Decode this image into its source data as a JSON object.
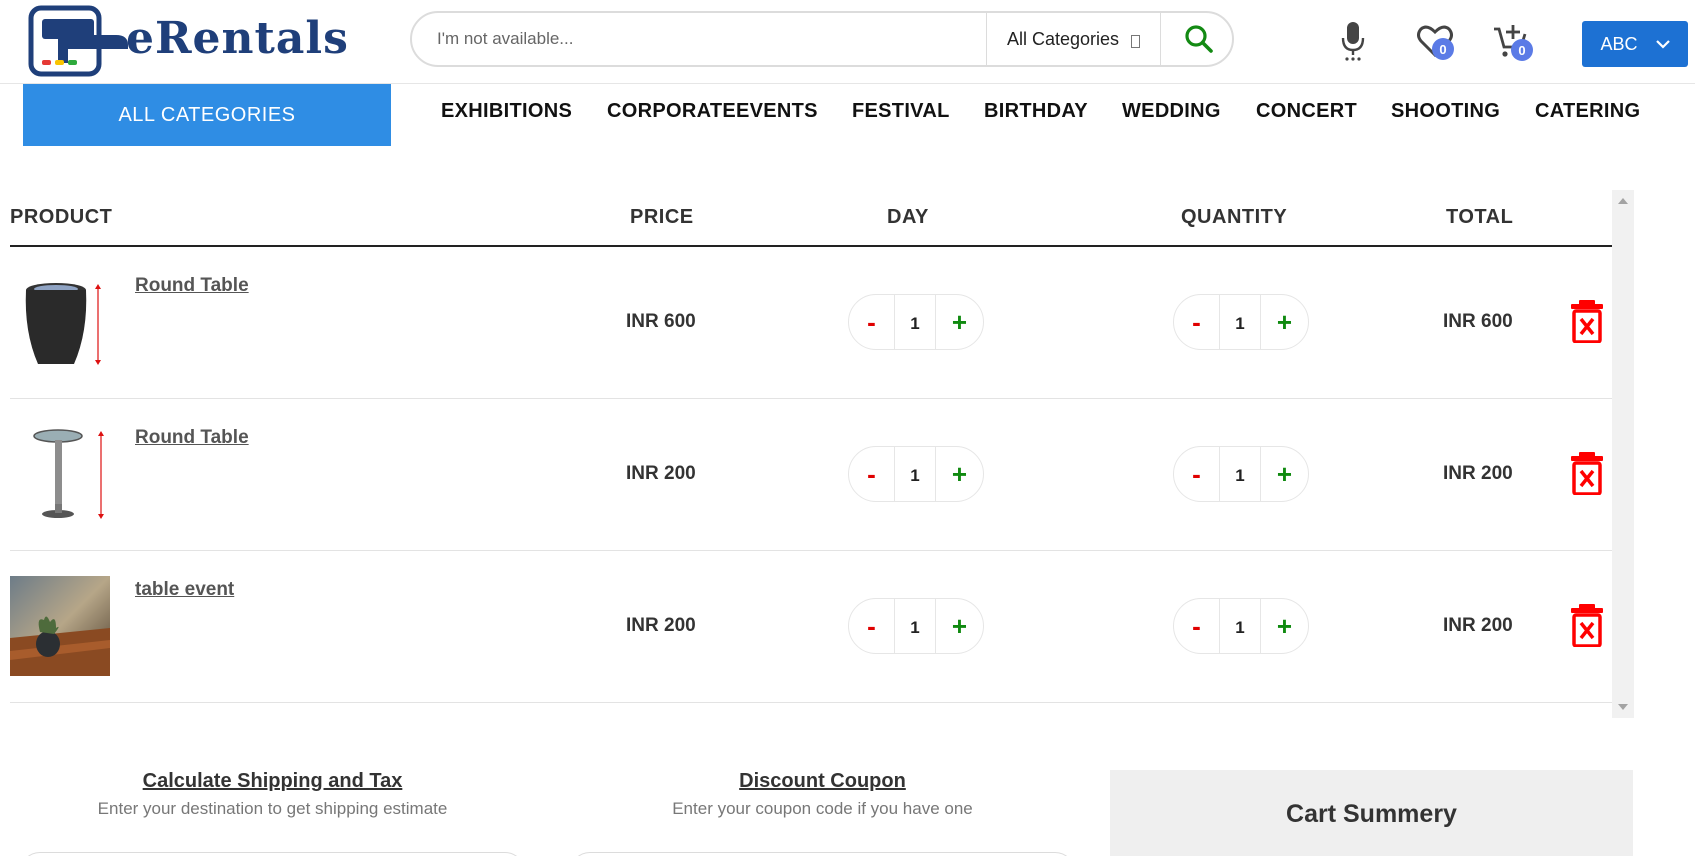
{
  "brand": {
    "name": "eRentals"
  },
  "search": {
    "placeholder": "I'm not available...",
    "category": "All Categories"
  },
  "header": {
    "wishlist_count": "0",
    "cart_count": "0",
    "user_label": "ABC"
  },
  "nav": {
    "all_categories": "ALL CATEGORIES",
    "items": [
      "EXHIBITIONS",
      "CORPORATEEVENTS",
      "FESTIVAL",
      "BIRTHDAY",
      "WEDDING",
      "CONCERT",
      "SHOOTING",
      "CATERING"
    ]
  },
  "cart": {
    "headers": {
      "product": "PRODUCT",
      "price": "PRICE",
      "day": "DAY",
      "quantity": "QUANTITY",
      "total": "TOTAL"
    },
    "rows": [
      {
        "name": "Round Table",
        "price": "INR 600",
        "day": "1",
        "quantity": "1",
        "total": "INR 600"
      },
      {
        "name": "Round Table",
        "price": "INR 200",
        "day": "1",
        "quantity": "1",
        "total": "INR 200"
      },
      {
        "name": "table event",
        "price": "INR 200",
        "day": "1",
        "quantity": "1",
        "total": "INR 200"
      }
    ],
    "minus_label": "-",
    "plus_label": "+"
  },
  "shipping": {
    "title": "Calculate Shipping and Tax",
    "subtitle": "Enter your destination to get shipping estimate"
  },
  "coupon": {
    "title": "Discount Coupon",
    "subtitle": "Enter your coupon code if you have one"
  },
  "summary": {
    "title": "Cart Summery"
  },
  "colors": {
    "primary": "#2f8de4",
    "brand": "#1f3f7a",
    "danger": "#e00000",
    "success": "#108a10",
    "badge": "#5b7be6"
  }
}
